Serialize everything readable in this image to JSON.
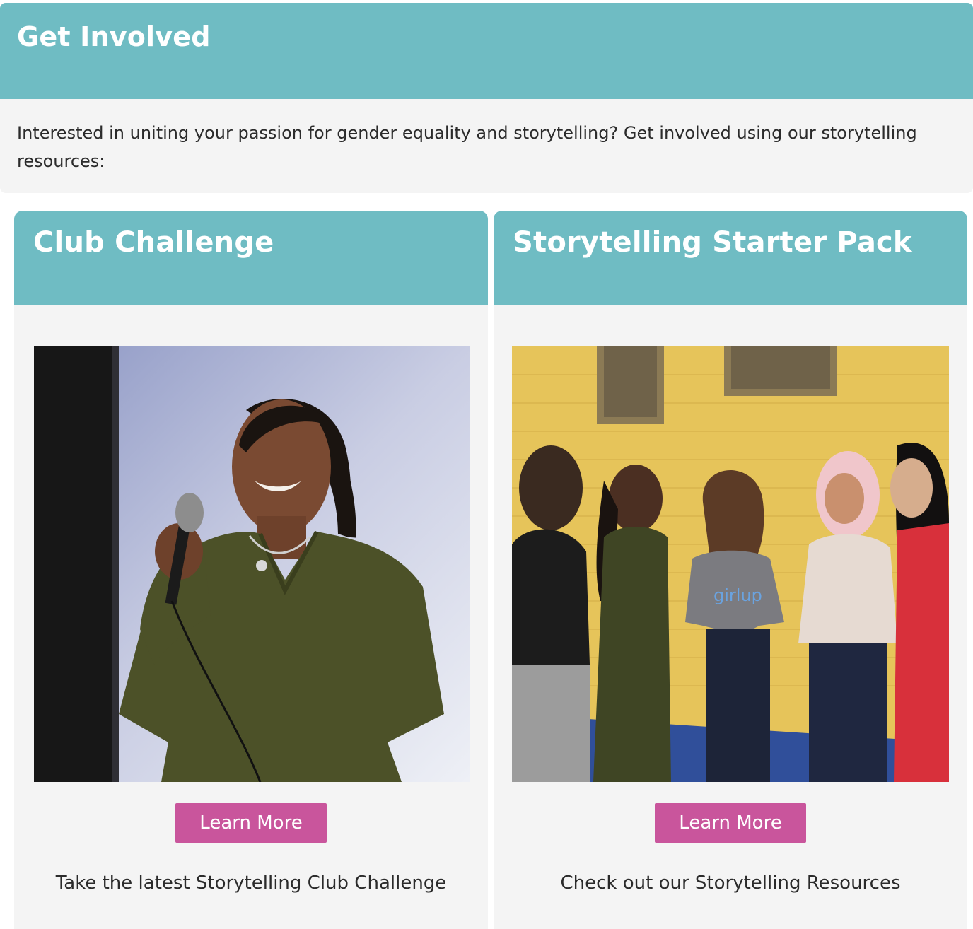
{
  "colors": {
    "accent_teal": "#6fbcc3",
    "button_pink": "#c9559c",
    "card_bg": "#f4f4f4"
  },
  "intro": {
    "title": "Get Involved",
    "text": "Interested in uniting your passion for gender equality and storytelling? Get involved using our storytelling resources:"
  },
  "cards": [
    {
      "title": "Club Challenge",
      "button_label": "Learn More",
      "caption": "Take the latest Storytelling Club Challenge",
      "image": "young-woman-speaking-into-microphone-photo"
    },
    {
      "title": "Storytelling Starter Pack",
      "button_label": "Learn More",
      "caption": "Check out our Storytelling Resources",
      "image": "group-of-young-women-by-yellow-wall-photo",
      "shirt_text": "girlup"
    }
  ]
}
